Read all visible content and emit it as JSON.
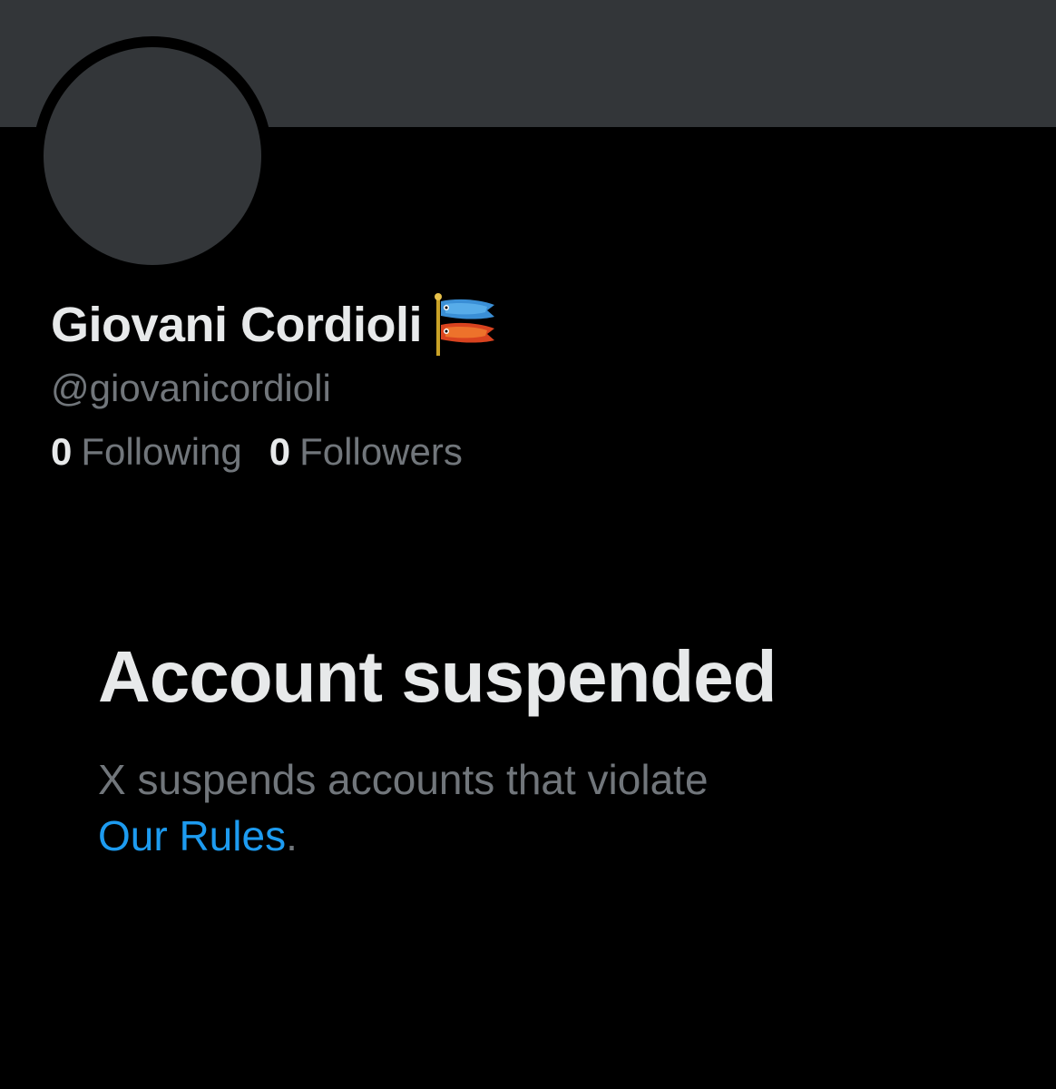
{
  "profile": {
    "display_name": "Giovani Cordioli",
    "name_emoji_icon": "carp-streamer-icon",
    "handle": "@giovanicordioli",
    "following_count": "0",
    "following_label": "Following",
    "followers_count": "0",
    "followers_label": "Followers"
  },
  "suspension": {
    "title": "Account suspended",
    "message": "X suspends accounts that violate",
    "link_text": "Our Rules",
    "trailing": "."
  },
  "colors": {
    "background": "#000000",
    "banner": "#333639",
    "primary_text": "#e7e9ea",
    "secondary_text": "#71767b",
    "link": "#1d9bf0"
  }
}
